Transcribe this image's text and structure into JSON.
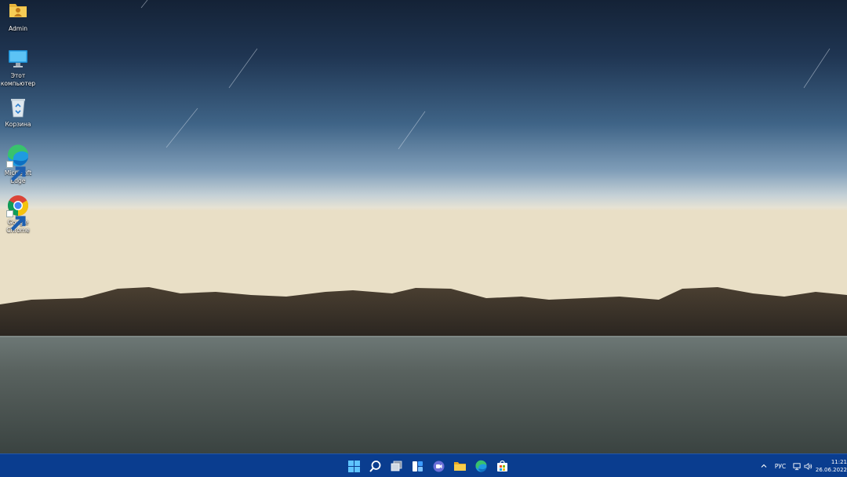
{
  "desktop": {
    "icons": [
      {
        "label": "Admin",
        "icon": "user-folder-icon"
      },
      {
        "label": "Этот компьютер",
        "icon": "monitor-icon"
      },
      {
        "label": "Корзина",
        "icon": "recycle-bin-icon"
      },
      {
        "label": "Microsoft Edge",
        "icon": "edge-icon"
      },
      {
        "label": "Google Chrome",
        "icon": "chrome-icon"
      }
    ]
  },
  "taskbar": {
    "pinned": [
      {
        "icon": "windows-start-icon"
      },
      {
        "icon": "search-icon"
      },
      {
        "icon": "task-view-icon"
      },
      {
        "icon": "widgets-icon"
      },
      {
        "icon": "teams-chat-icon"
      },
      {
        "icon": "file-explorer-icon"
      },
      {
        "icon": "edge-icon"
      },
      {
        "icon": "microsoft-store-icon"
      }
    ],
    "tray": {
      "language": "РУС",
      "time": "11:21",
      "date": "26.06.2022"
    }
  },
  "colors": {
    "taskbar": "#0a3d8f",
    "sky_top": "#142236",
    "horizon": "#e8e4d8",
    "water": "#4a5553"
  }
}
